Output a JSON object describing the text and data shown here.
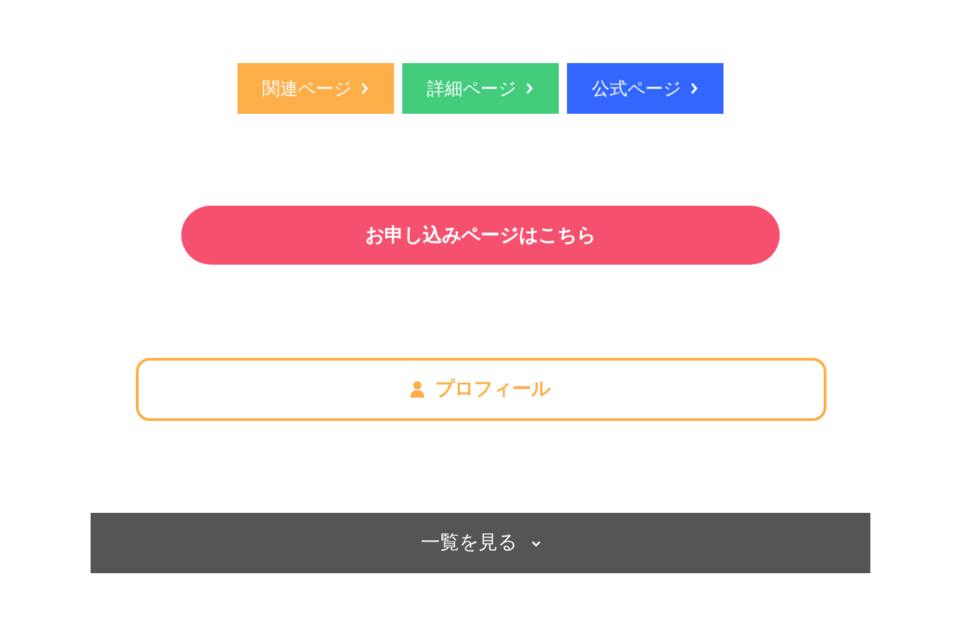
{
  "link_buttons": [
    {
      "label": "関連ページ",
      "color": "#fdae49"
    },
    {
      "label": "詳細ページ",
      "color": "#42cc7c"
    },
    {
      "label": "公式ページ",
      "color": "#3366ff"
    }
  ],
  "apply_button": {
    "label": "お申し込みページはこちら"
  },
  "profile_button": {
    "label": "プロフィール"
  },
  "more_bar": {
    "label": "一覧を見る"
  }
}
